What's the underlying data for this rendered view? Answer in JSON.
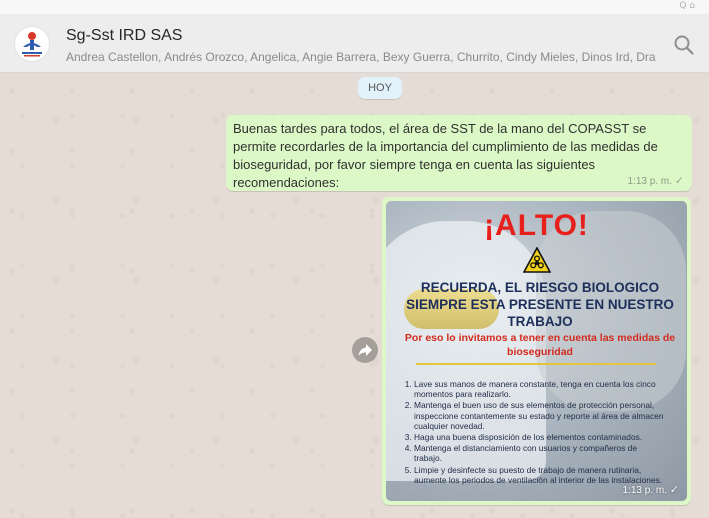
{
  "window": {
    "top_glyphs": "Q  ⌂"
  },
  "header": {
    "title": "Sg-Sst IRD SAS",
    "members": "Andrea Castellon, Andrés Orozco, Angelica, Angie Barrera, Bexy Guerra, Churrito, Cindy Mieles, Dinos Ird, Dra..."
  },
  "chat": {
    "day_chip": "HOY",
    "message1": {
      "text": "Buenas tardes para todos, el área de SST de la mano del COPASST se permite recordarles de la importancia del cumplimiento de las medidas de bioseguridad, por favor siempre tenga en cuenta las siguientes recomendaciones:",
      "time": "1:13 p. m.",
      "status": "✓"
    },
    "message2": {
      "poster": {
        "title": "¡ALTO!",
        "headline": "RECUERDA, EL RIESGO BIOLOGICO SIEMPRE ESTA PRESENTE EN NUESTRO TRABAJO",
        "subline": "Por eso lo invitamos a tener en cuenta las medidas de bioseguridad",
        "items": [
          "Lave sus manos de manera constante, tenga en cuenta los cinco momentos para realizarlo.",
          "Mantenga el buen uso de sus elementos de protección personal, inspeccione contantemente su estado y reporte al área de almacen cualquier novedad.",
          "Haga una buena disposición de los elementos contaminados.",
          "Mantenga el distanciamiento con usuarios y compañeros de trabajo.",
          "Limpie y desinfecte su puesto de trabajo de manera rutinaria, aumente los periodos de ventilación al interior de las instalaciones."
        ]
      },
      "time": "1:13 p. m.",
      "status": "✓"
    }
  },
  "icons": {
    "search": "search-icon",
    "forward": "forward-icon",
    "hazard": "biohazard-icon"
  },
  "colors": {
    "outgoing_bubble": "#dcf8c6",
    "chat_background": "#e5ddd5",
    "header": "#ededed",
    "alert_red": "#e8201c"
  }
}
